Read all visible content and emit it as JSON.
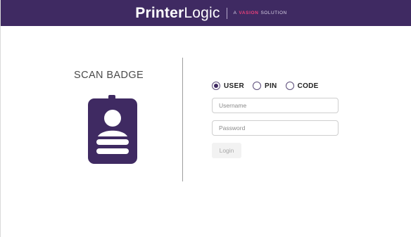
{
  "header": {
    "logo_bold": "Printer",
    "logo_light": "Logic",
    "tagline_prefix": "A",
    "tagline_accent": "VASION",
    "tagline_suffix": "SOLUTION",
    "background_color": "#3f2a62"
  },
  "badge_panel": {
    "title": "SCAN BADGE",
    "icon": "id-badge-icon",
    "icon_color": "#3f2a62"
  },
  "login_form": {
    "auth_options": [
      {
        "label": "USER",
        "selected": true
      },
      {
        "label": "PIN",
        "selected": false
      },
      {
        "label": "CODE",
        "selected": false
      }
    ],
    "username_placeholder": "Username",
    "password_placeholder": "Password",
    "login_label": "Login",
    "login_enabled": false
  }
}
